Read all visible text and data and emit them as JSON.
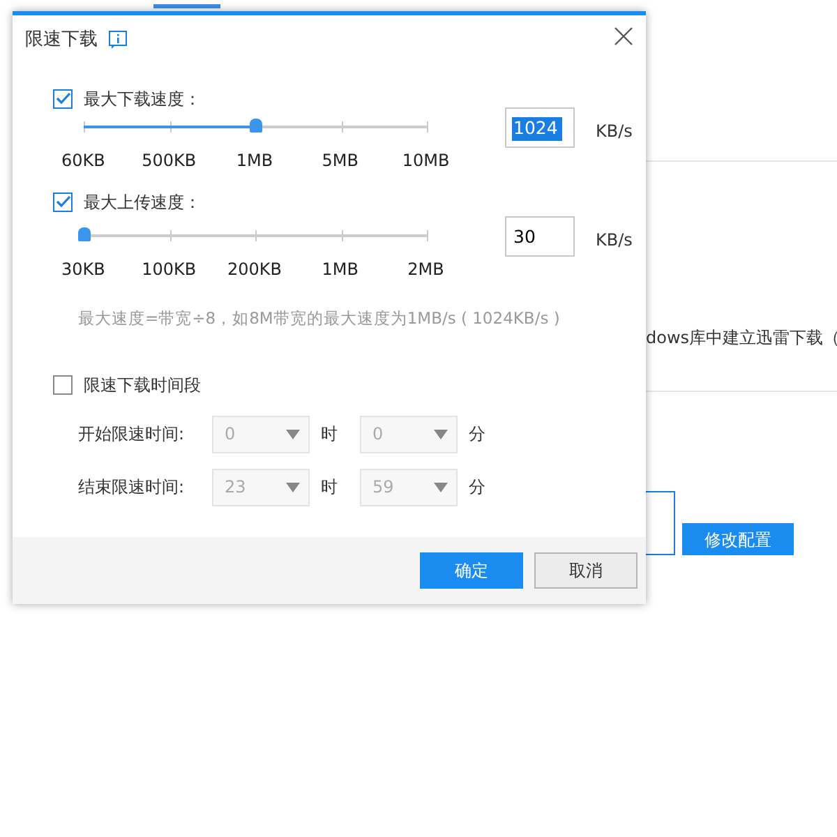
{
  "background": {
    "text": "dows库中建立迅雷下载（",
    "button": "修改配置"
  },
  "dialog": {
    "title": "限速下载",
    "limits": [
      {
        "label": "最大下载速度：",
        "checked": true,
        "ticks": [
          "60KB",
          "500KB",
          "1MB",
          "5MB",
          "10MB"
        ],
        "level": 0.5,
        "value": "1024",
        "value_selected": true,
        "unit": "KB/s"
      },
      {
        "label": "最大上传速度：",
        "checked": true,
        "ticks": [
          "30KB",
          "100KB",
          "200KB",
          "1MB",
          "2MB"
        ],
        "level": 0,
        "value": "30",
        "value_selected": false,
        "unit": "KB/s"
      }
    ],
    "hint": "最大速度=带宽÷8，如8M带宽的最大速度为1MB/s ( 1024KB/s )",
    "schedule": {
      "label": "限速下载时间段",
      "checked": false,
      "rows": [
        {
          "label": "开始限速时间:",
          "hour": "0",
          "hour_unit": "时",
          "minute": "0",
          "minute_unit": "分",
          "disabled": true
        },
        {
          "label": "结束限速时间:",
          "hour": "23",
          "hour_unit": "时",
          "minute": "59",
          "minute_unit": "分",
          "disabled": true
        }
      ]
    },
    "buttons": [
      {
        "label": "确定",
        "kind": "primary"
      },
      {
        "label": "取消",
        "kind": "secondary"
      }
    ]
  }
}
